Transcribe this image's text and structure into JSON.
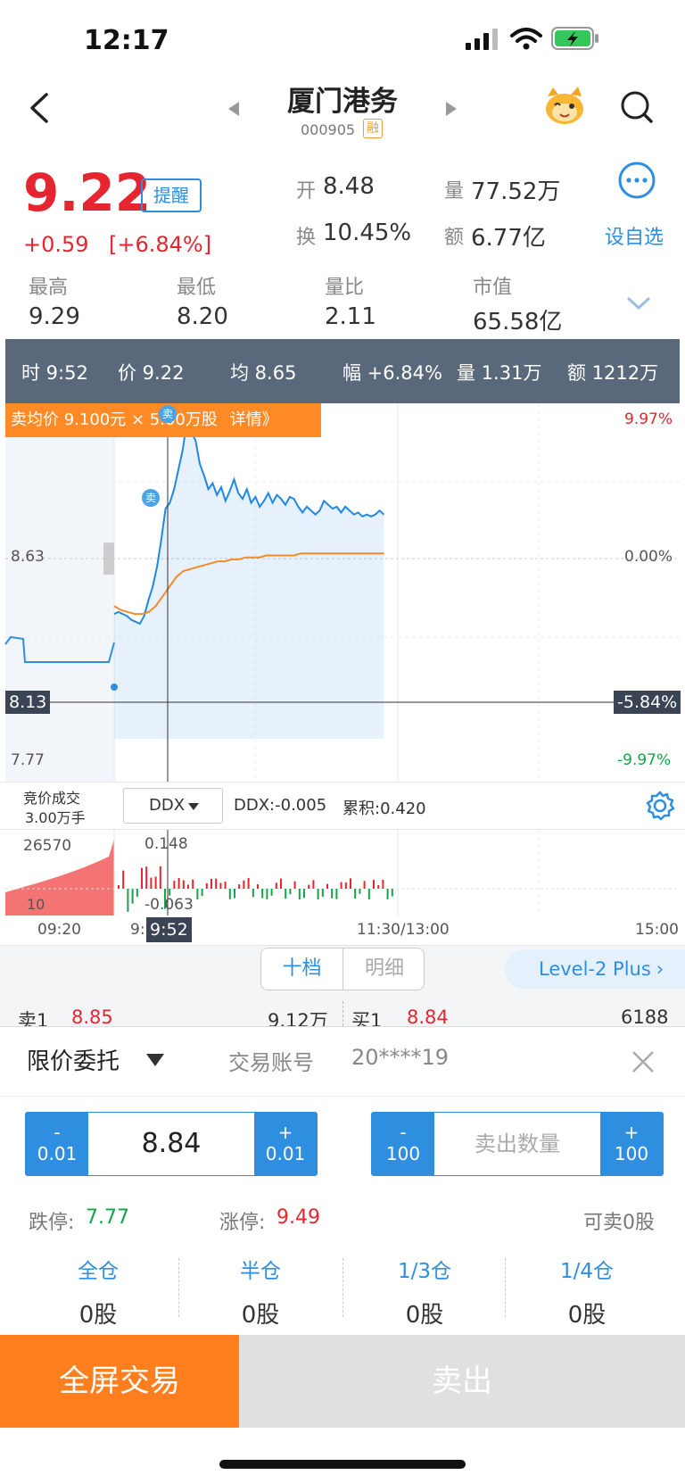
{
  "status": {
    "time": "12:17"
  },
  "header": {
    "title": "厦门港务",
    "code": "000905",
    "tag": "融"
  },
  "quote": {
    "price": "9.22",
    "change": "+0.59",
    "change_pct": "[+6.84%]",
    "remind_label": "提醒",
    "open_label": "开",
    "open": "8.48",
    "turnover_label": "换",
    "turnover": "10.45%",
    "volume_label": "量",
    "volume": "77.52万",
    "amount_label": "额",
    "amount": "6.77亿",
    "add_watch_label": "设自选",
    "high_label": "最高",
    "high": "9.29",
    "low_label": "最低",
    "low": "8.20",
    "vol_ratio_label": "量比",
    "vol_ratio": "2.11",
    "mkt_cap_label": "市值",
    "mkt_cap": "65.58亿"
  },
  "infobar": {
    "time": "时 9:52",
    "price": "价 9.22",
    "avg": "均 8.65",
    "range": "幅 +6.84%",
    "vol": "量 1.31万",
    "amt": "额 1212万"
  },
  "chart_data": {
    "type": "line",
    "y_left_ticks": [
      "8.63",
      "7.77"
    ],
    "y_right_ticks": [
      "9.97%",
      "0.00%",
      "-9.97%"
    ],
    "cursor_price": "8.13",
    "cursor_pct": "-5.84%",
    "banner": "卖均价 9.100元 × 5.00万股",
    "banner_link": "详情》",
    "sell_marker": "卖",
    "x_labels": [
      "09:20",
      "9:",
      "11:30/13:00",
      "15:00"
    ],
    "cursor_time": "9:52",
    "ylim": [
      7.77,
      9.49
    ],
    "price_series": [
      8.41,
      8.42,
      8.41,
      8.4,
      8.38,
      8.37,
      8.36,
      8.4,
      8.48,
      8.55,
      8.65,
      8.79,
      8.95,
      8.98,
      9.05,
      9.15,
      9.25,
      9.4,
      9.34,
      9.3,
      9.18,
      9.12,
      9.05,
      9.08,
      9.02,
      9.06,
      8.99,
      9.04,
      9.1,
      9.03,
      9.0,
      9.05,
      8.98,
      9.01,
      8.96,
      8.99,
      9.03,
      8.98,
      9.02,
      9.0,
      8.97,
      9.01,
      9.0,
      8.96,
      8.93,
      8.96,
      8.94,
      8.92,
      8.94,
      8.99,
      8.97,
      8.95,
      8.96,
      8.93,
      8.96,
      8.94,
      8.92,
      8.93,
      8.91,
      8.92,
      8.91,
      8.92,
      8.94,
      8.92
    ],
    "avg_series": [
      8.45,
      8.43,
      8.42,
      8.41,
      8.41,
      8.42,
      8.45,
      8.5,
      8.55,
      8.6,
      8.63,
      8.64,
      8.65,
      8.66,
      8.67,
      8.68,
      8.68,
      8.69,
      8.69,
      8.7,
      8.7,
      8.7,
      8.71,
      8.71,
      8.71,
      8.71,
      8.71,
      8.72,
      8.72,
      8.72,
      8.72,
      8.72,
      8.72,
      8.72,
      8.72,
      8.72,
      8.72,
      8.72,
      8.72,
      8.72
    ]
  },
  "ddx": {
    "auction_label": "竞价成交",
    "auction_value": "3.00万手",
    "selector": "DDX",
    "ddx_value": "DDX:-0.005",
    "cum_value": "累积:0.420"
  },
  "vol_chart": {
    "left_value": "26570",
    "upper": "0.148",
    "lower": "-0.063",
    "left_small": "10"
  },
  "tabs": {
    "tab1": "十档",
    "tab2": "明细",
    "level2": "Level-2 Plus"
  },
  "orderbook": {
    "sell_label": "卖1",
    "sell_price": "8.85",
    "sell_vol": "9.12万",
    "buy_label": "买1",
    "buy_price": "8.84",
    "buy_vol": "6188"
  },
  "panel": {
    "order_type": "限价委托",
    "account_label": "交易账号",
    "account": "20****19",
    "price_value": "8.84",
    "price_minus": "-",
    "price_minus_step": "0.01",
    "price_plus": "+",
    "price_plus_step": "0.01",
    "qty_minus": "-",
    "qty_minus_step": "100",
    "qty_plus": "+",
    "qty_plus_step": "100",
    "qty_placeholder": "卖出数量",
    "limit_down_label": "跌停:",
    "limit_down": "7.77",
    "limit_up_label": "涨停:",
    "limit_up": "9.49",
    "sellable": "可卖0股",
    "positions": [
      {
        "label": "全仓",
        "value": "0股"
      },
      {
        "label": "半仓",
        "value": "0股"
      },
      {
        "label": "1/3仓",
        "value": "0股"
      },
      {
        "label": "1/4仓",
        "value": "0股"
      }
    ]
  },
  "bottom": {
    "fullscreen": "全屏交易",
    "sell": "卖出"
  },
  "colors": {
    "accent": "#2e8ee0",
    "up": "#e5252f",
    "down": "#15a44a",
    "orange": "#ff7f1e",
    "infobar": "#59687a"
  }
}
